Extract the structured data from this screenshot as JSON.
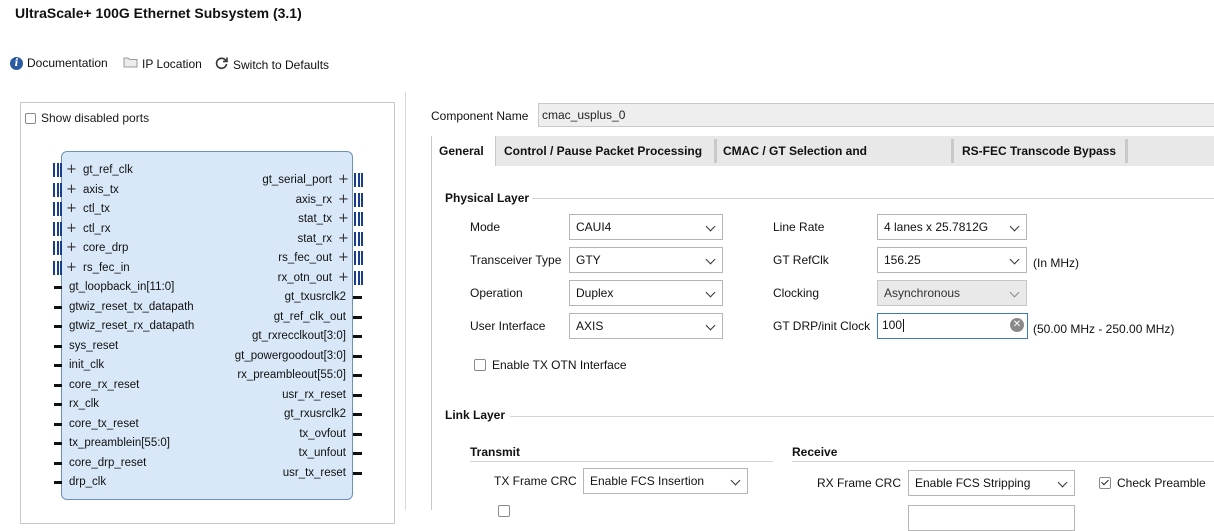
{
  "title": "UltraScale+ 100G Ethernet Subsystem (3.1)",
  "toolbar": {
    "documentation": "Documentation",
    "ip_location": "IP Location",
    "switch_defaults": "Switch to Defaults"
  },
  "left_panel": {
    "show_disabled_ports": "Show disabled ports",
    "left_ports": [
      {
        "label": "gt_ref_clk",
        "type": "bus"
      },
      {
        "label": "axis_tx",
        "type": "bus"
      },
      {
        "label": "ctl_tx",
        "type": "bus"
      },
      {
        "label": "ctl_rx",
        "type": "bus"
      },
      {
        "label": "core_drp",
        "type": "bus"
      },
      {
        "label": "rs_fec_in",
        "type": "bus"
      },
      {
        "label": "gt_loopback_in[11:0]",
        "type": "pin"
      },
      {
        "label": "gtwiz_reset_tx_datapath",
        "type": "pin"
      },
      {
        "label": "gtwiz_reset_rx_datapath",
        "type": "pin"
      },
      {
        "label": "sys_reset",
        "type": "pin"
      },
      {
        "label": "init_clk",
        "type": "pin"
      },
      {
        "label": "core_rx_reset",
        "type": "pin"
      },
      {
        "label": "rx_clk",
        "type": "pin"
      },
      {
        "label": "core_tx_reset",
        "type": "pin"
      },
      {
        "label": "tx_preamblein[55:0]",
        "type": "pin"
      },
      {
        "label": "core_drp_reset",
        "type": "pin"
      },
      {
        "label": "drp_clk",
        "type": "pin"
      }
    ],
    "right_ports": [
      {
        "label": "gt_serial_port",
        "type": "bus"
      },
      {
        "label": "axis_rx",
        "type": "bus"
      },
      {
        "label": "stat_tx",
        "type": "bus"
      },
      {
        "label": "stat_rx",
        "type": "bus"
      },
      {
        "label": "rs_fec_out",
        "type": "bus"
      },
      {
        "label": "rx_otn_out",
        "type": "bus"
      },
      {
        "label": "gt_txusrclk2",
        "type": "pin"
      },
      {
        "label": "gt_ref_clk_out",
        "type": "pin"
      },
      {
        "label": "gt_rxrecclkout[3:0]",
        "type": "pin"
      },
      {
        "label": "gt_powergoodout[3:0]",
        "type": "pin"
      },
      {
        "label": "rx_preambleout[55:0]",
        "type": "pin"
      },
      {
        "label": "usr_rx_reset",
        "type": "pin"
      },
      {
        "label": "gt_rxusrclk2",
        "type": "pin"
      },
      {
        "label": "tx_ovfout",
        "type": "pin"
      },
      {
        "label": "tx_unfout",
        "type": "pin"
      },
      {
        "label": "usr_tx_reset",
        "type": "pin"
      }
    ]
  },
  "component": {
    "label": "Component Name",
    "value": "cmac_usplus_0"
  },
  "tabs": [
    "General",
    "Control / Pause Packet Processing",
    "CMAC / GT Selection and Configuration",
    "RS-FEC Transcode Bypass"
  ],
  "physical_layer": {
    "heading": "Physical Layer",
    "mode": {
      "label": "Mode",
      "value": "CAUI4"
    },
    "transceiver_type": {
      "label": "Transceiver Type",
      "value": "GTY"
    },
    "operation": {
      "label": "Operation",
      "value": "Duplex"
    },
    "user_interface": {
      "label": "User Interface",
      "value": "AXIS"
    },
    "line_rate": {
      "label": "Line Rate",
      "value": "4 lanes x 25.7812G"
    },
    "gt_refclk": {
      "label": "GT RefClk",
      "value": "156.25",
      "unit": "(In MHz)"
    },
    "clocking": {
      "label": "Clocking",
      "value": "Asynchronous"
    },
    "gt_drp_clock": {
      "label": "GT DRP/init Clock",
      "value": "100",
      "range": "(50.00 MHz - 250.00 MHz)"
    },
    "enable_tx_otn": {
      "label": "Enable TX OTN Interface",
      "checked": false
    }
  },
  "link_layer": {
    "heading": "Link Layer",
    "transmit": {
      "heading": "Transmit",
      "tx_frame_crc": {
        "label": "TX Frame CRC",
        "value": "Enable FCS Insertion"
      }
    },
    "receive": {
      "heading": "Receive",
      "rx_frame_crc": {
        "label": "RX Frame CRC",
        "value": "Enable FCS Stripping"
      },
      "check_preamble": {
        "label": "Check Preamble",
        "checked": true
      }
    }
  }
}
